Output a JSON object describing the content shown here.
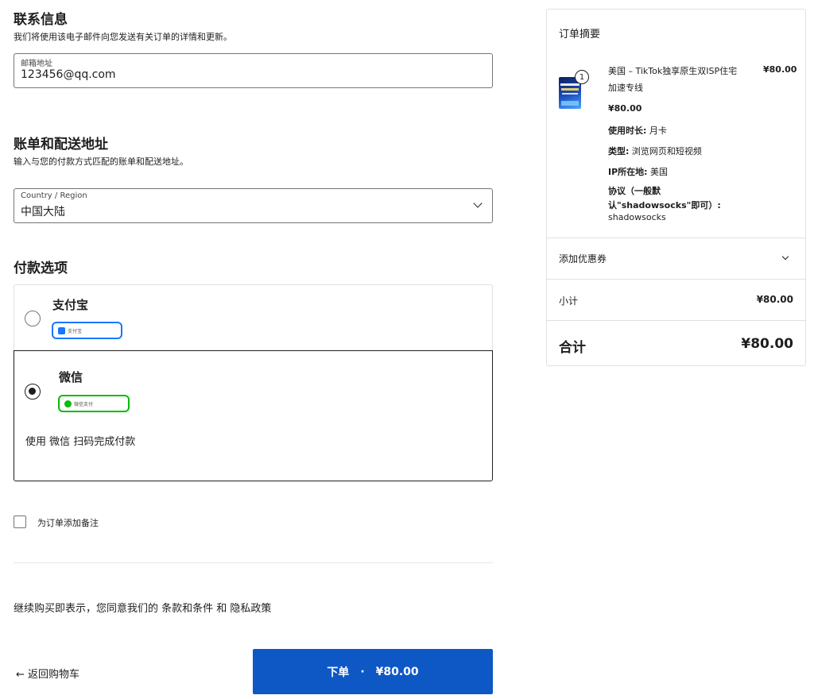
{
  "contact": {
    "title": "联系信息",
    "desc": "我们将使用该电子邮件向您发送有关订单的详情和更新。",
    "email_label": "邮箱地址",
    "email_value": "123456@qq.com"
  },
  "billing": {
    "title": "账单和配送地址",
    "desc": "输入与您的付款方式匹配的账单和配送地址。",
    "country_label": "Country / Region",
    "country_value": "中国大陆"
  },
  "payment": {
    "title": "付款选项",
    "options": [
      {
        "name": "支付宝",
        "badge": "支付宝",
        "selected": false
      },
      {
        "name": "微信",
        "badge": "微信支付",
        "selected": true,
        "instruction": "使用 微信 扫码完成付款"
      }
    ]
  },
  "note_label": "为订单添加备注",
  "terms": "继续购买即表示，您同意我们的 条款和条件 和 隐私政策",
  "back_label": "← 返回购物车",
  "place_order": {
    "label": "下单",
    "sep": "·",
    "amount": "¥80.00"
  },
  "summary": {
    "title": "订单摘要",
    "item": {
      "quantity": "1",
      "name_line1": "美国 – TikTok独享原生双ISP住宅",
      "name_line2": "加速专线",
      "price": "¥80.00",
      "unit_price": "¥80.00",
      "attrs": [
        {
          "key": "使用时长:",
          "value": " 月卡"
        },
        {
          "key": "类型:",
          "value": " 浏览网页和短视频"
        },
        {
          "key": "IP所在地:",
          "value": " 美国"
        }
      ],
      "protocol_key_line1": "协议（一般默",
      "protocol_key_line2": "认\"shadowsocks\"即可）:",
      "protocol_value": "shadowsocks"
    },
    "coupon_label": "添加优惠券",
    "subtotal_label": "小计",
    "subtotal_value": "¥80.00",
    "total_label": "合计",
    "total_value": "¥80.00"
  },
  "colors": {
    "accent": "#0e58c6",
    "alipay": "#1677ff",
    "wechat": "#09bb07"
  }
}
